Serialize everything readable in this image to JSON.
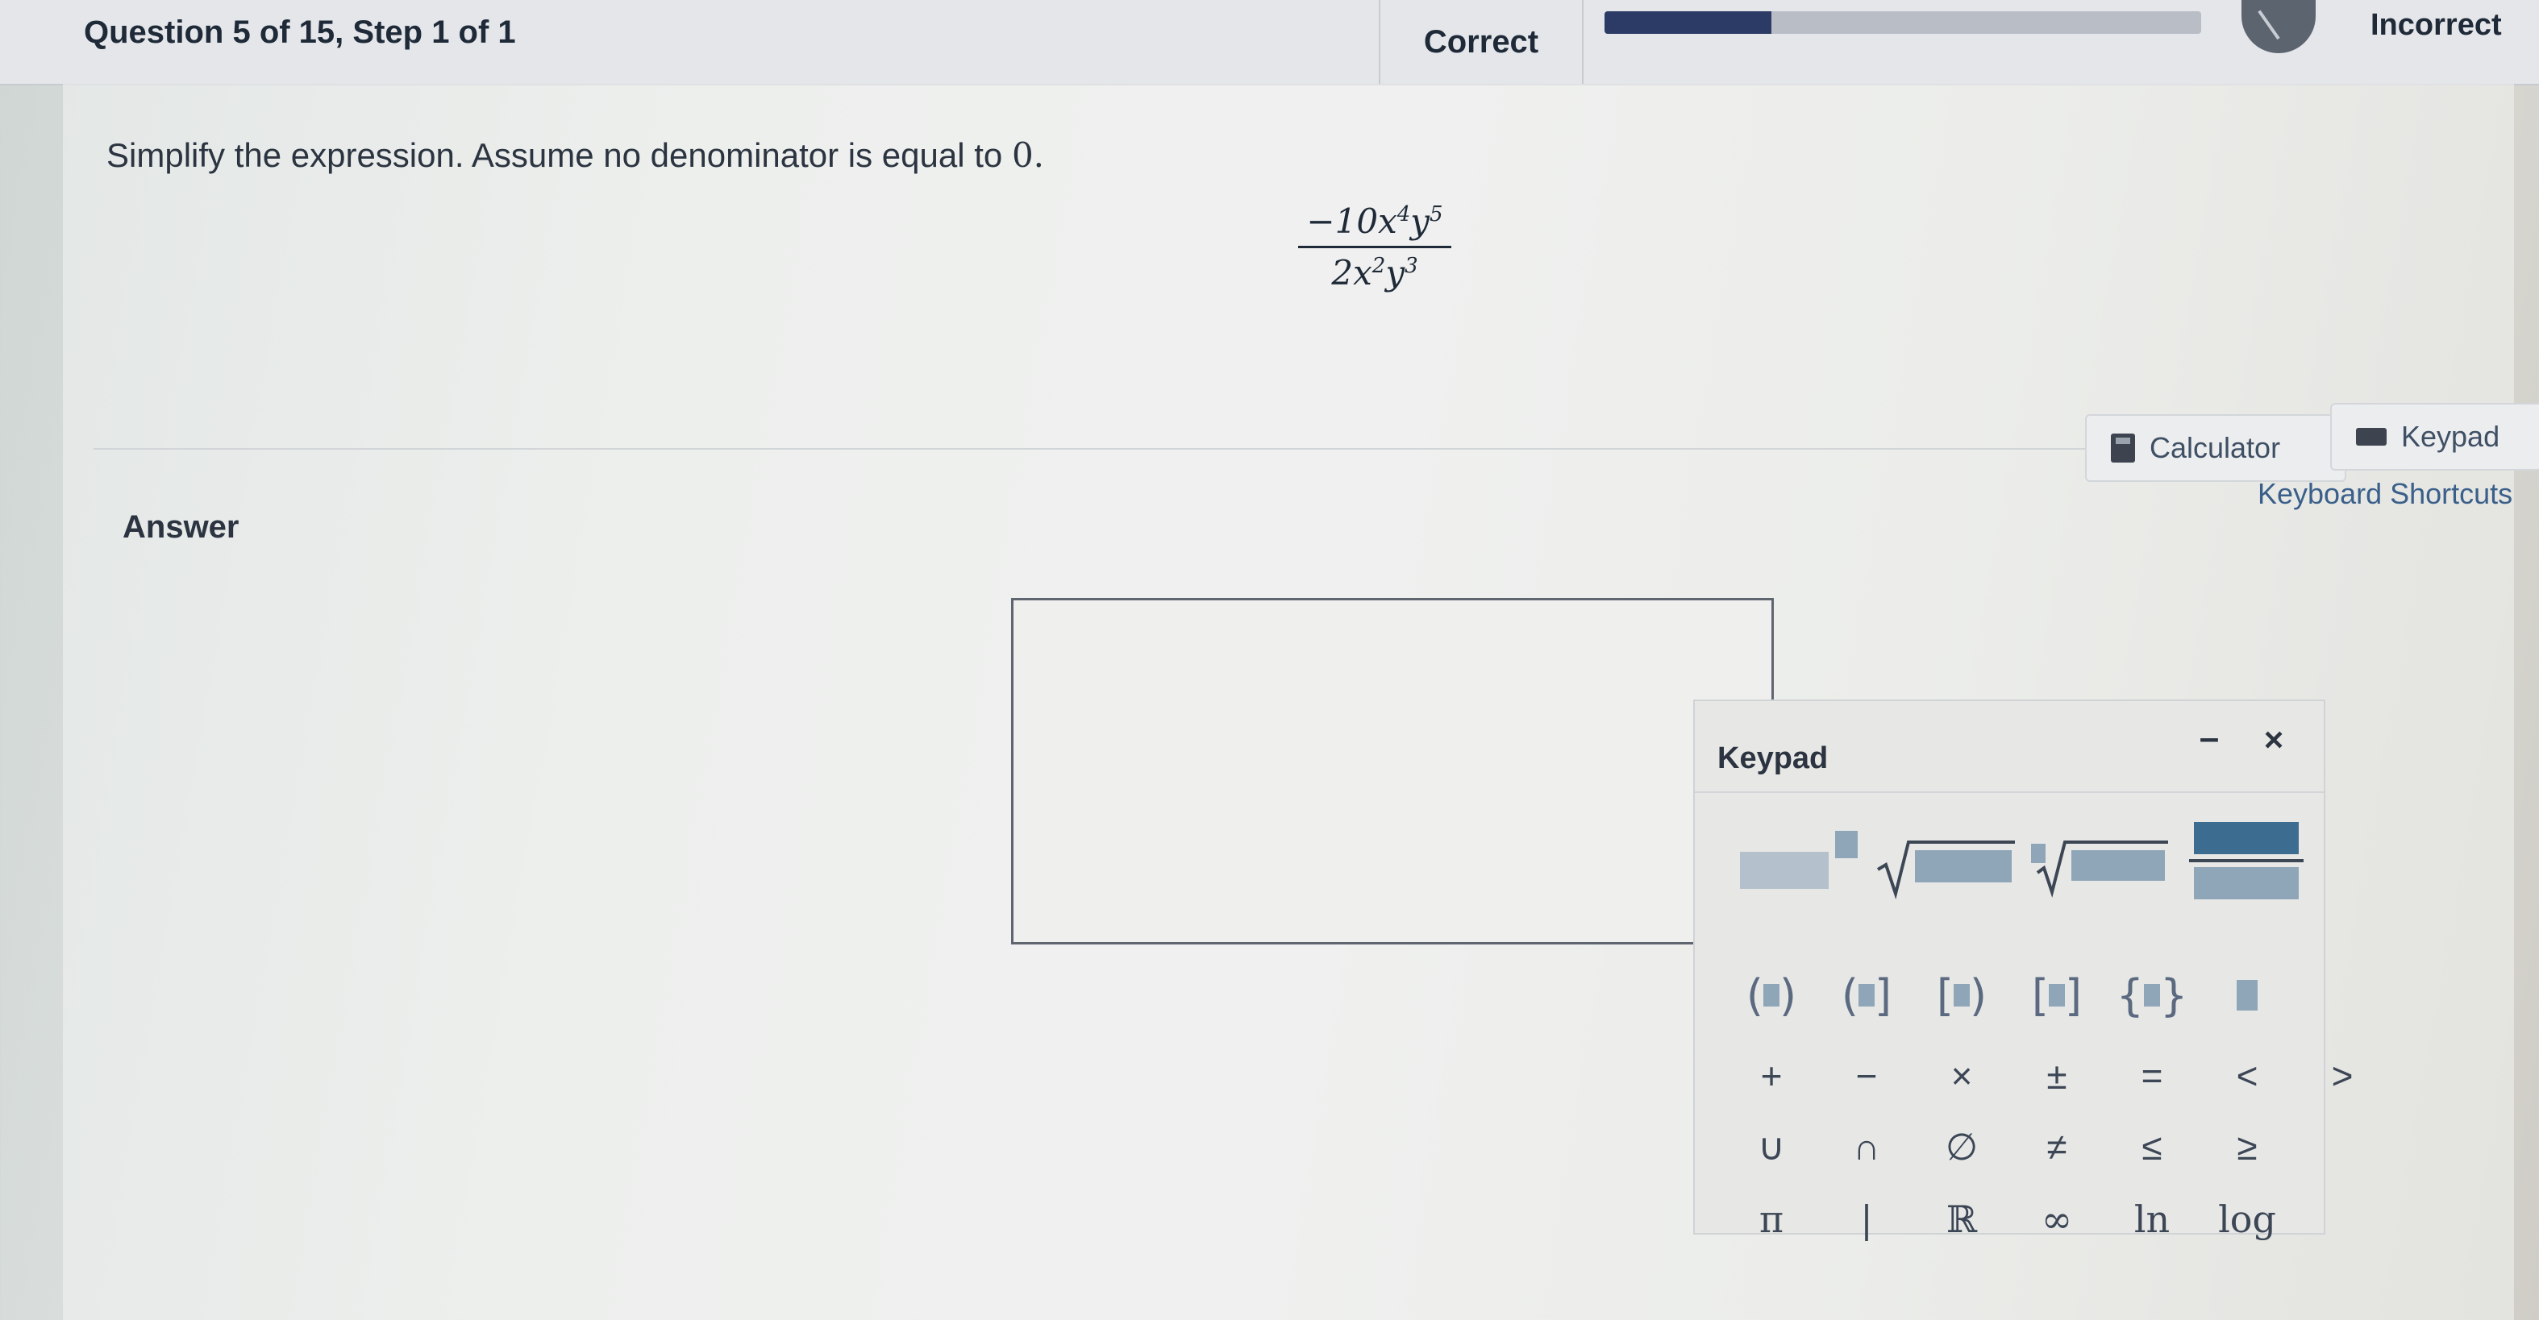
{
  "header": {
    "question_label": "Question 5 of 15,  Step 1 of 1",
    "correct_label": "Correct",
    "incorrect_label": "Incorrect",
    "progress": 0.28
  },
  "question": {
    "prompt": "Simplify the expression. Assume no denominator is equal to ",
    "prompt_zero": "0.",
    "expression": {
      "numerator_coef": "−10",
      "numerator_var1": "x",
      "numerator_exp1": "4",
      "numerator_var2": "y",
      "numerator_exp2": "5",
      "denominator_coef": "2",
      "denominator_var1": "x",
      "denominator_exp1": "2",
      "denominator_var2": "y",
      "denominator_exp2": "3"
    }
  },
  "tools": {
    "calculator_label": "Calculator",
    "keypad_label": "Keypad",
    "shortcuts_label": "Keyboard Shortcuts"
  },
  "answer": {
    "label": "Answer",
    "value": ""
  },
  "keypad": {
    "title": "Keypad",
    "minimize_symbol": "–",
    "close_symbol": "×",
    "row1": [
      "+",
      "−",
      "×",
      "±",
      "=",
      "<",
      ">"
    ],
    "row2": [
      "∪",
      "∩",
      "∅",
      "≠",
      "≤",
      "≥"
    ],
    "row3": [
      "π",
      "|",
      "ℝ",
      "∞",
      "ln",
      "log"
    ]
  },
  "icons": [
    "calculator-icon",
    "keyboard-icon",
    "gauge-icon"
  ],
  "colors": {
    "progress_fill": "#2c3a66",
    "placeholder": "#8fa6b9",
    "link": "#3a5f8a"
  }
}
